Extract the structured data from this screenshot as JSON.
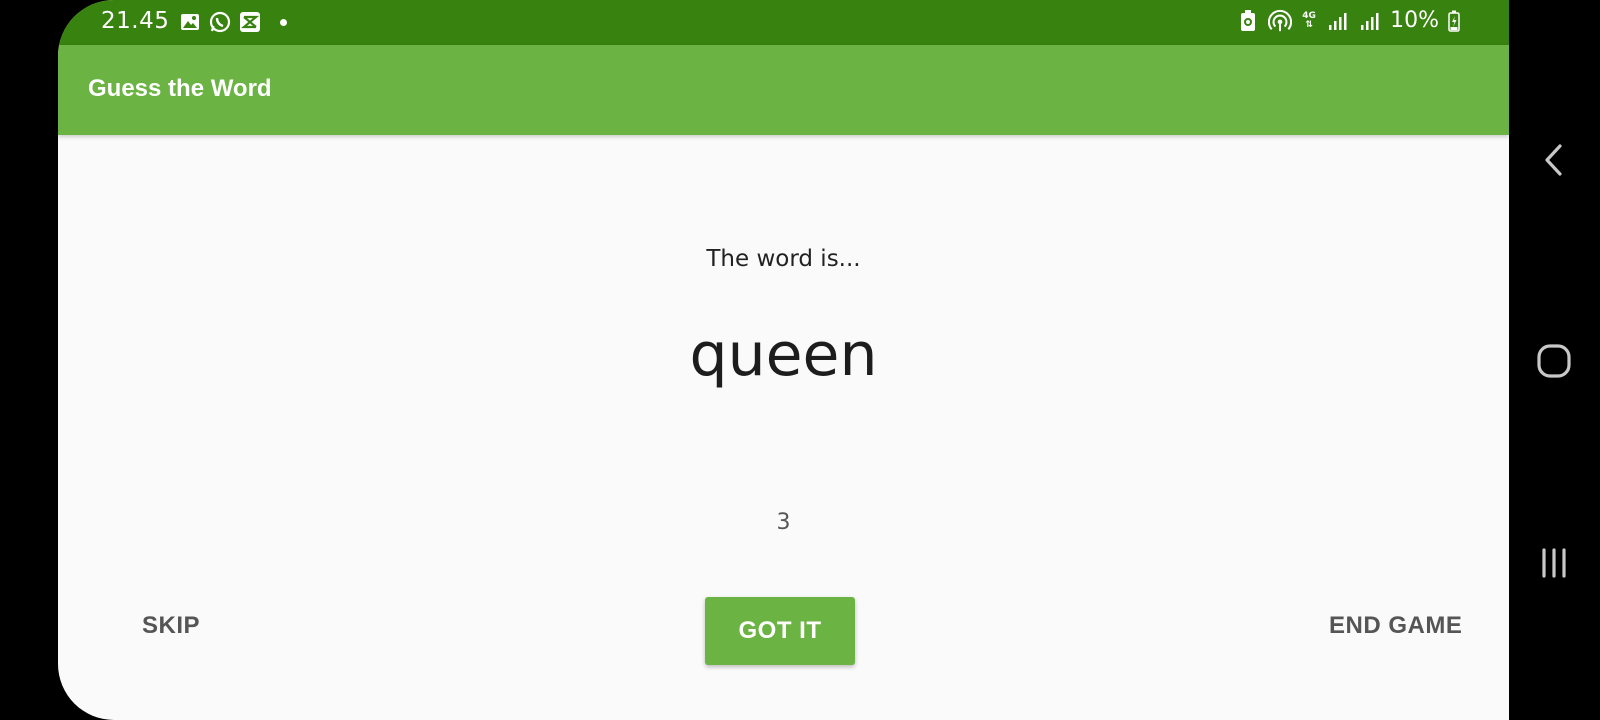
{
  "status_bar": {
    "time": "21.45",
    "battery_percent": "10%",
    "network": "4G",
    "icons_left": [
      "gallery-icon",
      "whatsapp-icon",
      "capcut-icon",
      "notification-dot"
    ],
    "icons_right": [
      "battery-saver-icon",
      "hotspot-icon",
      "4g-icon",
      "signal-icon",
      "signal-icon",
      "battery-charging-icon"
    ]
  },
  "app_bar": {
    "title": "Guess the Word"
  },
  "game": {
    "word_label": "The word is...",
    "word": "queen",
    "score": "3"
  },
  "actions": {
    "skip_label": "SKIP",
    "got_it_label": "GOT IT",
    "end_game_label": "END GAME"
  },
  "nav_bar": {
    "icons": [
      "back-icon",
      "home-icon",
      "recents-icon"
    ]
  },
  "colors": {
    "status_bar": "#38820f",
    "app_bar": "#6bb342",
    "accent": "#6bb342",
    "background": "#fafafa",
    "text_primary": "#1d1d1d",
    "text_secondary": "#555555"
  }
}
